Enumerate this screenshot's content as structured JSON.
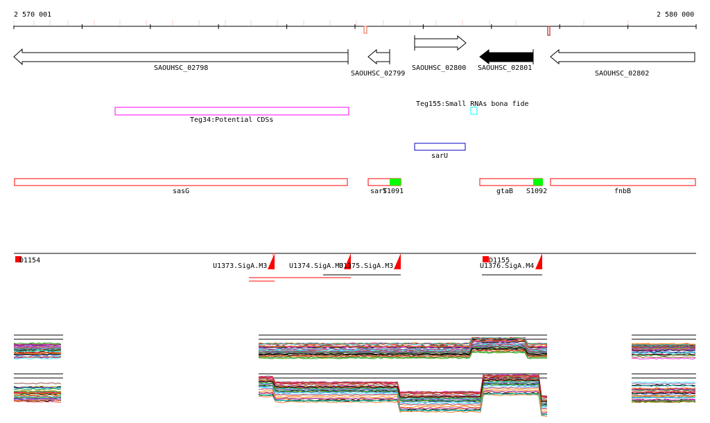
{
  "ruler": {
    "start_label": "2 570 001",
    "end_label": "2 580 000"
  },
  "genes": [
    {
      "name": "SAOUHSC_02798",
      "strand": "-",
      "filled": false
    },
    {
      "name": "SAOUHSC_02799",
      "strand": "-",
      "filled": false
    },
    {
      "name": "SAOUHSC_02800",
      "strand": "+",
      "filled": false
    },
    {
      "name": "SAOUHSC_02801",
      "strand": "-",
      "filled": true
    },
    {
      "name": "SAOUHSC_02802",
      "strand": "-",
      "filled": false
    }
  ],
  "features": {
    "teg34": "Teg34:Potential CDSs",
    "teg155": "Teg155:Small RNAs bona fide",
    "saru": "sarU"
  },
  "annotations": [
    {
      "name": "sasG"
    },
    {
      "name": "sarT"
    },
    {
      "name": "S1091"
    },
    {
      "name": "gtaB"
    },
    {
      "name": "S1092"
    },
    {
      "name": "fnbB"
    }
  ],
  "promoters": [
    {
      "name": "D1154"
    },
    {
      "name": "U1373.SigA.M3"
    },
    {
      "name": "U1374.SigA.M3"
    },
    {
      "name": "U1375.SigA.M3"
    },
    {
      "name": "D1155"
    },
    {
      "name": "U1376.SigA.M4"
    }
  ],
  "colors": {
    "teg34": "#ff00ff",
    "teg155": "#00ffff",
    "saru": "#0000cc",
    "annotation": "#ff0000",
    "srna": "#00ff00",
    "promoter": "#ff0000"
  }
}
